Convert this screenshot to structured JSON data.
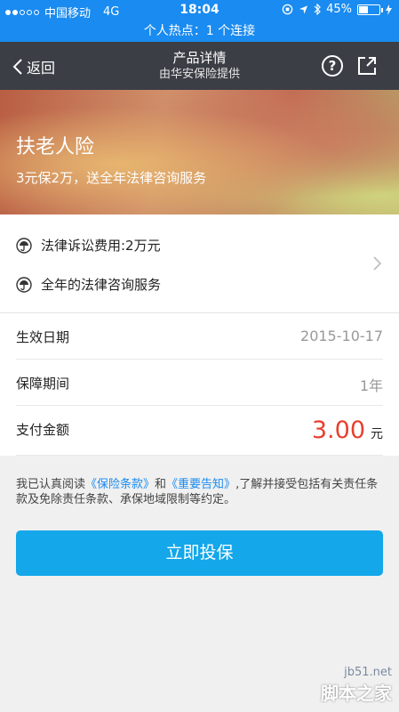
{
  "status_bar": {
    "carrier": "中国移动",
    "network": "4G",
    "time": "18:04",
    "battery": "45%",
    "battery_level": 0.45
  },
  "hotspot": "个人热点：1 个连接",
  "navbar": {
    "back_label": "返回",
    "title": "产品详情",
    "subtitle": "由华安保险提供",
    "help_icon": "question-circle-icon",
    "share_icon": "share-icon"
  },
  "banner": {
    "title": "扶老人险",
    "subtitle": "3元保2万，送全年法律咨询服务"
  },
  "features": [
    {
      "icon": "umbrella-icon",
      "label": "法律诉讼费用:2万元"
    },
    {
      "icon": "umbrella-icon",
      "label": "全年的法律咨询服务"
    }
  ],
  "details": {
    "effective_date_label": "生效日期",
    "effective_date": "2015-10-17",
    "period_label": "保障期间",
    "period": "1年",
    "payment_label": "支付金额",
    "payment_amount": "3.00",
    "payment_unit": "元"
  },
  "agreement": {
    "prefix": "我已认真阅读",
    "link1": "《保险条款》",
    "and": "和",
    "link2": "《重要告知》",
    "suffix": ",了解并接受包括有关责任条款及免除责任条款、承保地域限制等约定。"
  },
  "cta_label": "立即投保",
  "watermark": {
    "domain": "jb51.net",
    "name": "脚本之家"
  },
  "colors": {
    "status_bg": "#1a8bf0",
    "nav_bg": "#3b3e45",
    "accent": "#14a7ea",
    "amount": "#e8402e",
    "link": "#1a8bf0"
  }
}
